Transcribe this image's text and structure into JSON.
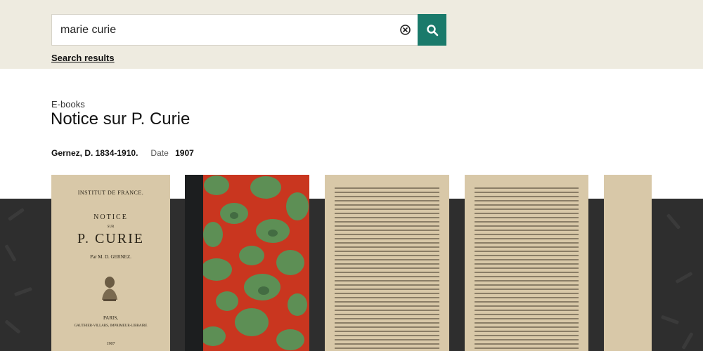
{
  "search": {
    "value": "marie curie",
    "results_link": "Search results"
  },
  "record": {
    "category": "E-books",
    "title": "Notice sur P. Curie",
    "author": "Gernez, D. 1834-1910.",
    "date_label": "Date",
    "date": "1907"
  },
  "cover": {
    "institute": "INSTITUT DE FRANCE.",
    "notice": "NOTICE",
    "sur": "SUR",
    "name": "P. CURIE",
    "by": "Par M. D. GERNEZ.",
    "city": "PARIS,",
    "publisher": "GAUTHIER-VILLARS, IMPRIMEUR-LIBRAIRE",
    "year": "1907"
  },
  "colors": {
    "accent": "#1a7a6b",
    "top_band": "#eeebe0",
    "dark_band": "#2e2e2e"
  },
  "icons": {
    "clear": "clear-circle-x-icon",
    "search": "magnifier-icon"
  }
}
